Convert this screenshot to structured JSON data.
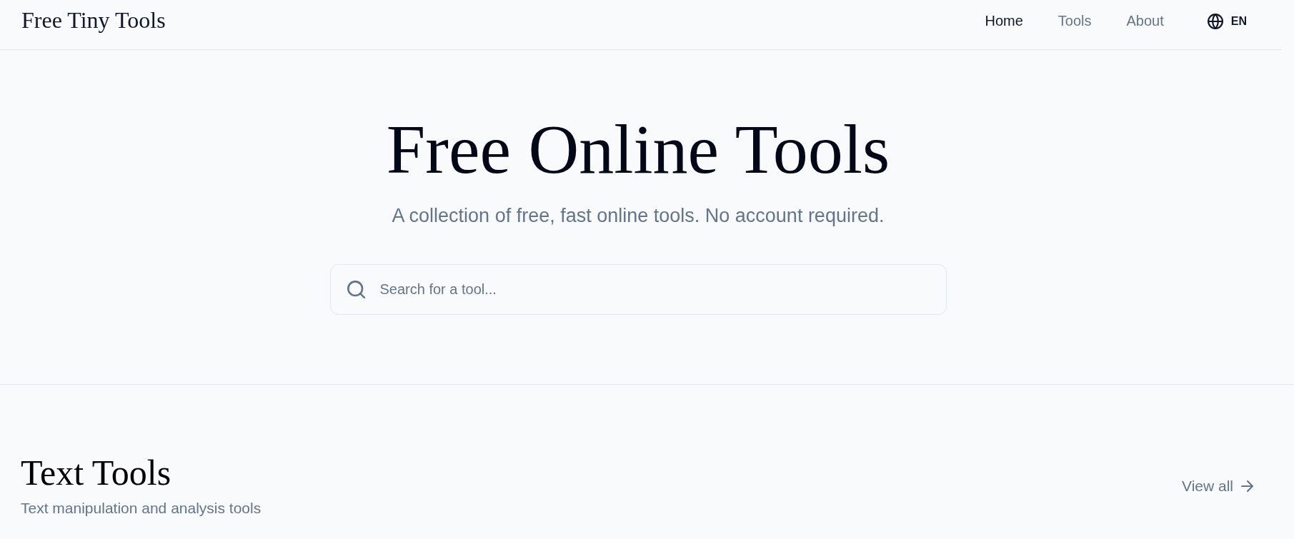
{
  "header": {
    "logo": "Free Tiny Tools",
    "nav": [
      {
        "label": "Home",
        "selected": true
      },
      {
        "label": "Tools",
        "selected": false
      },
      {
        "label": "About",
        "selected": false
      }
    ],
    "language": "EN"
  },
  "hero": {
    "title": "Free Online Tools",
    "subtitle": "A collection of free, fast online tools. No account required.",
    "search": {
      "placeholder": "Search for a tool..."
    }
  },
  "section": {
    "title": "Text Tools",
    "description": "Text manipulation and analysis tools",
    "link": "View all"
  }
}
